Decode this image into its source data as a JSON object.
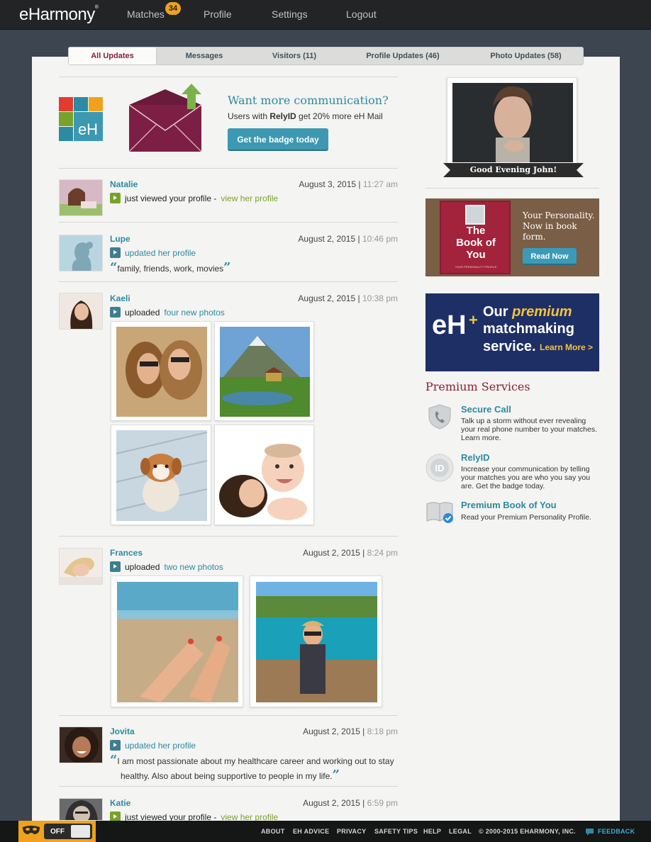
{
  "header": {
    "logo": "eHarmony",
    "nav": [
      {
        "label": "Matches",
        "badge": "34"
      },
      {
        "label": "Profile"
      },
      {
        "label": "Settings"
      },
      {
        "label": "Logout"
      }
    ]
  },
  "tabs": [
    "All Updates",
    "Messages",
    "Visitors (11)",
    "Profile Updates (46)",
    "Photo Updates (58)"
  ],
  "promo": {
    "title": "Want more communication?",
    "text_prefix": "Users with ",
    "text_brand": "RelyID",
    "text_suffix": " get 20% more eH Mail",
    "button": "Get the badge today",
    "logo_text": "eH"
  },
  "feed": [
    {
      "name": "Natalie",
      "date": "August 3, 2015",
      "time": "11:27 am",
      "action": "just viewed your profile -",
      "link": "view her profile"
    },
    {
      "name": "Lupe",
      "date": "August 2, 2015",
      "time": "10:46 pm",
      "action": "",
      "link": "updated her profile",
      "quote": "family, friends, work, movies"
    },
    {
      "name": "Kaeli",
      "date": "August 2, 2015",
      "time": "10:38 pm",
      "action": "uploaded",
      "link": "four new photos"
    },
    {
      "name": "Frances",
      "date": "August 2, 2015",
      "time": "8:24 pm",
      "action": "uploaded",
      "link": "two new photos"
    },
    {
      "name": "Jovita",
      "date": "August 2, 2015",
      "time": "8:18 pm",
      "action": "",
      "link": "updated her profile",
      "quote_1": "I am most passionate about my healthcare career and working out to stay",
      "quote_2": "healthy. Also about being supportive to people in my life."
    },
    {
      "name": "Katie",
      "date": "August 2, 2015",
      "time": "6:59 pm",
      "action": "just viewed your profile -",
      "link": "view her profile"
    }
  ],
  "sidebar": {
    "greeting": "Good Evening John!",
    "book_ad": {
      "book_title_1": "The",
      "book_title_2": "Book of",
      "book_title_3": "You",
      "book_small": "YOUR PERSONALITY PROFILE",
      "copy": "Your Personality. Now in book form.",
      "button": "Read Now"
    },
    "eh_ad": {
      "logo": "eH",
      "plus": "+",
      "line1_a": "Our ",
      "line1_b": "premium",
      "line2": "matchmaking",
      "line3": "service.",
      "link": "Learn More >"
    },
    "premium_title": "Premium Services",
    "services": [
      {
        "name": "Secure Call",
        "desc": "Talk up a storm without ever revealing your real phone number to your matches. Learn more."
      },
      {
        "name": "RelyID",
        "desc": "Increase your communication by telling your matches you are who you say you are. Get the badge today."
      },
      {
        "name": "Premium Book of You",
        "desc": "Read your Premium Personality Profile."
      }
    ]
  },
  "footer": {
    "toggle": "OFF",
    "links": [
      "ABOUT",
      "EH ADVICE",
      "PRIVACY",
      "SAFETY TIPS",
      "HELP",
      "LEGAL"
    ],
    "copyright": "© 2000-2015 EHARMONY, INC.",
    "feedback": "FEEDBACK"
  },
  "colors": {
    "accent": "#2c8aa3",
    "brand_red": "#8a1e3b",
    "badge": "#f0a21c",
    "green": "#78a32a"
  }
}
